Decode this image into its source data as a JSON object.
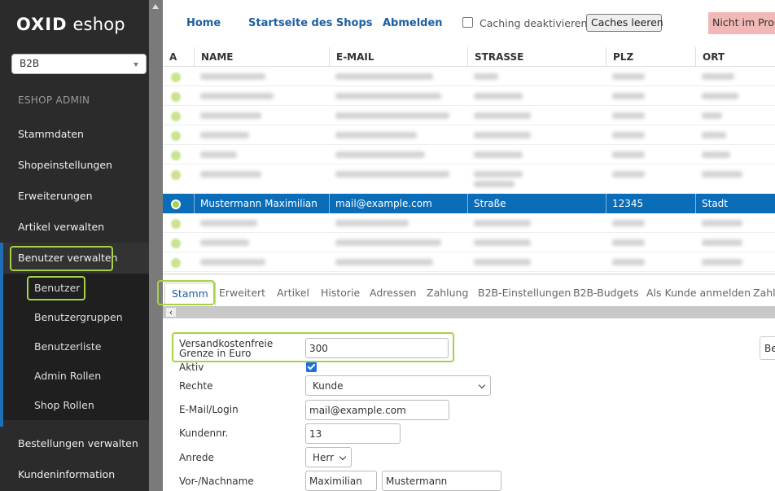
{
  "sidebar": {
    "logo_bold": "OXID",
    "logo_rest": "eshop",
    "shop_selected": "B2B",
    "admin_label": "ESHOP ADMIN",
    "items": [
      "Stammdaten",
      "Shopeinstellungen",
      "Erweiterungen",
      "Artikel verwalten",
      "Benutzer verwalten"
    ],
    "subitems": [
      "Benutzer",
      "Benutzergruppen",
      "Benutzerliste",
      "Admin Rollen",
      "Shop Rollen"
    ],
    "items_after": [
      "Bestellungen verwalten",
      "Kundeninformation"
    ]
  },
  "topbar": {
    "links": [
      "Home",
      "Startseite des Shops",
      "Abmelden"
    ],
    "caching_label": "Caching deaktivieren",
    "caches_button": "Caches leeren",
    "production_badge": "Nicht im Produktivmodus"
  },
  "table": {
    "headers": [
      "A",
      "NAME",
      "E-MAIL",
      "STRASSE",
      "PLZ",
      "ORT"
    ],
    "selected_row": {
      "name": "Mustermann Maximilian",
      "email": "mail@example.com",
      "street": "Straße",
      "zip": "12345",
      "city": "Stadt"
    }
  },
  "tabs": [
    "Stamm",
    "Erweitert",
    "Artikel",
    "Historie",
    "Adressen",
    "Zahlung",
    "B2B-Einstellungen",
    "B2B-Budgets",
    "Als Kunde anmelden",
    "Zahlungsarten"
  ],
  "form": {
    "shipping_label": "Versandkostenfreie Grenze in Euro",
    "shipping_value": "300",
    "active_label": "Aktiv",
    "rights_label": "Rechte",
    "rights_value": "Kunde",
    "email_label": "E-Mail/Login",
    "email_value": "mail@example.com",
    "custnr_label": "Kundennr.",
    "custnr_value": "13",
    "salutation_label": "Anrede",
    "salutation_value": "Herr",
    "name_label": "Vor-/Nachname",
    "firstname_value": "Maximilian",
    "lastname_value": "Mustermann",
    "right_button": "Benutzer"
  },
  "colors": {
    "sidebar_bg": "#2b2b2b",
    "accent_blue": "#1d5fa3",
    "selected_row": "#0b6db8",
    "highlight_green": "#a6d245",
    "badge_red": "#f2b8b8"
  }
}
